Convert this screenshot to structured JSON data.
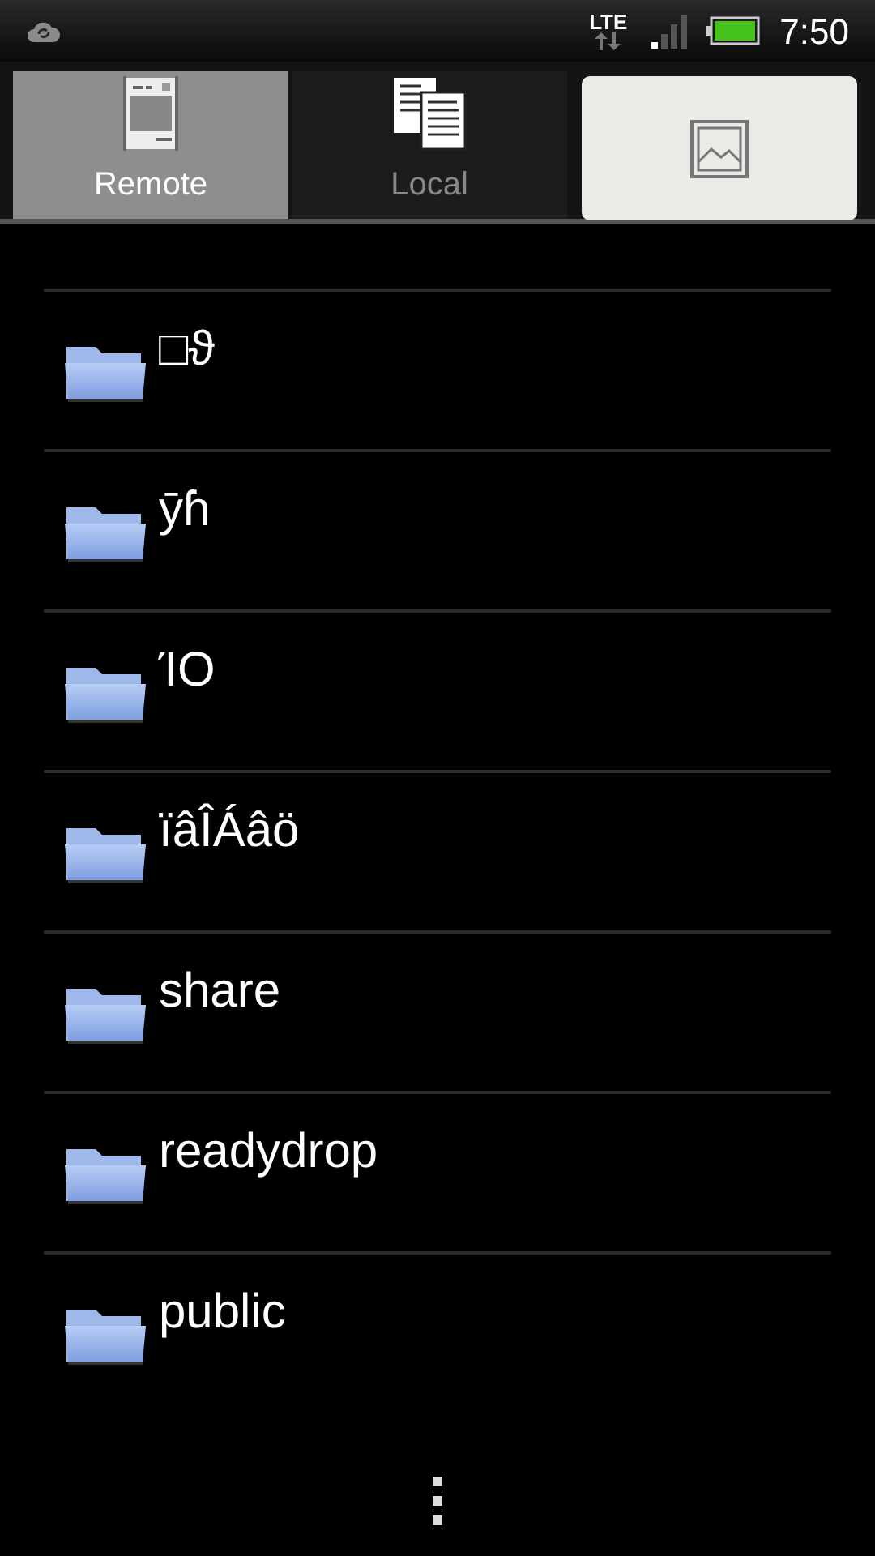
{
  "status_bar": {
    "network": "LTE",
    "time": "7:50"
  },
  "tabs": [
    {
      "label": "Remote",
      "selected": true
    },
    {
      "label": "Local",
      "selected": false
    }
  ],
  "folders": [
    {
      "name": "□ϑ"
    },
    {
      "name": "ȳɦ"
    },
    {
      "name": "ΊΟ"
    },
    {
      "name": "ïâÎÁâö"
    },
    {
      "name": "share"
    },
    {
      "name": "readydrop"
    },
    {
      "name": "public"
    }
  ]
}
